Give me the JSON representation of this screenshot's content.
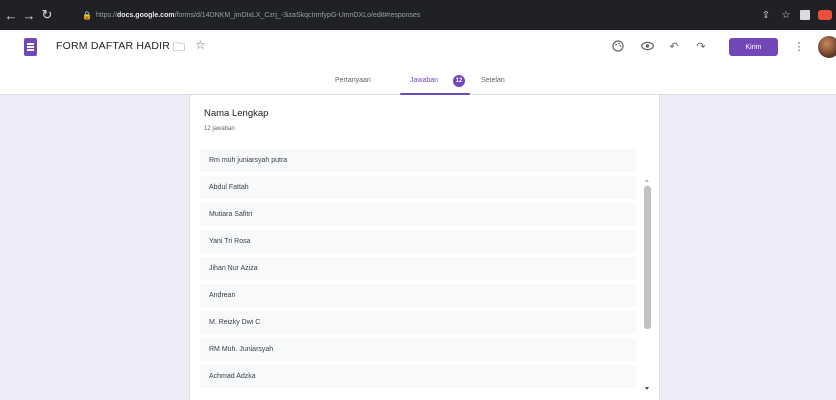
{
  "browser": {
    "url_scheme": "https://",
    "url_domain": "docs.google.com",
    "url_path": "/forms/d/14DNKM_jmDIxLX_Czrj_-3izaSkqcIrmfypG-UmnDXLo/edit#responses"
  },
  "header": {
    "form_title": "FORM DAFTAR HADIR",
    "send_label": "Kirim"
  },
  "tabs": {
    "questions": "Pertanyaan",
    "responses": "Jawaban",
    "responses_count": "12",
    "settings": "Setelan"
  },
  "question": {
    "title": "Nama Lengkap",
    "count_label": "12 jawaban",
    "answers": [
      "Rm muh juniarsyah putra",
      "Abdul Fattah",
      "Mutiara Safitri",
      "Yani Tri Rosa",
      "Jihan Nur Aziza",
      "Andrean",
      "M. Reizky Dwi C",
      "RM Muh. Juniarsyah",
      "Achmad Adzka"
    ]
  },
  "icons": {
    "forms_logo": "google-forms-icon",
    "folder": "folder-icon",
    "star": "star-icon",
    "palette": "palette-icon",
    "preview": "eye-icon",
    "undo": "undo-icon",
    "redo": "redo-icon",
    "more": "more-vert-icon"
  },
  "colors": {
    "accent": "#7248b9",
    "background": "#f0ebf8"
  }
}
